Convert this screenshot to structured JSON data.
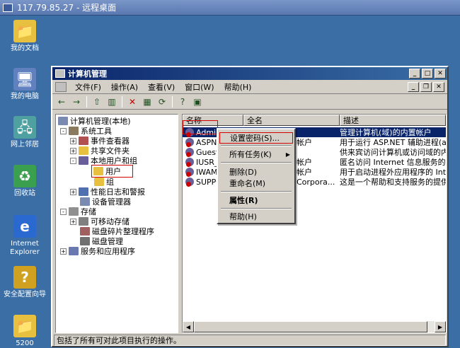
{
  "remote": {
    "title": "117.79.85.27 - 远程桌面"
  },
  "desktop_icons": [
    {
      "label": "我的文档",
      "icon": "folder-docs-icon",
      "color": "#e8c040"
    },
    {
      "label": "我的电脑",
      "icon": "computer-icon",
      "color": "#6080c0"
    },
    {
      "label": "网上邻居",
      "icon": "network-icon",
      "color": "#4fa0a0"
    },
    {
      "label": "回收站",
      "icon": "recycle-bin-icon",
      "color": "#3aa050"
    },
    {
      "label": "Internet Explorer",
      "icon": "ie-icon",
      "color": "#2a6ad0"
    },
    {
      "label": "安全配置向导",
      "icon": "security-wizard-icon",
      "color": "#d0a020"
    },
    {
      "label": "5200",
      "icon": "folder-icon",
      "color": "#e8c040"
    }
  ],
  "window": {
    "title": "计算机管理",
    "menu": [
      "文件(F)",
      "操作(A)",
      "查看(V)",
      "窗口(W)",
      "帮助(H)"
    ],
    "status": "包括了所有可对此项目执行的操作。"
  },
  "tree": [
    {
      "label": "计算机管理(本地)",
      "exp": ""
    },
    {
      "label": "系统工具",
      "exp": "-"
    },
    {
      "label": "事件查看器",
      "exp": "+"
    },
    {
      "label": "共享文件夹",
      "exp": "+"
    },
    {
      "label": "本地用户和组",
      "exp": "-"
    },
    {
      "label": "用户",
      "exp": ""
    },
    {
      "label": "组",
      "exp": ""
    },
    {
      "label": "性能日志和警报",
      "exp": "+"
    },
    {
      "label": "设备管理器",
      "exp": ""
    },
    {
      "label": "存储",
      "exp": "-"
    },
    {
      "label": "可移动存储",
      "exp": "+"
    },
    {
      "label": "磁盘碎片整理程序",
      "exp": ""
    },
    {
      "label": "磁盘管理",
      "exp": ""
    },
    {
      "label": "服务和应用程序",
      "exp": "+"
    }
  ],
  "list": {
    "columns": [
      "名称",
      "全名",
      "描述"
    ],
    "rows": [
      {
        "name": "Administr",
        "full": "",
        "desc": "管理计算机(域)的内置帐户"
      },
      {
        "name": "ASPNET",
        "full": "帐户",
        "desc": "用于运行 ASP.NET 辅助进程(as"
      },
      {
        "name": "Guest",
        "full": "",
        "desc": "供来宾访问计算机或访问域的内"
      },
      {
        "name": "IUSR_B",
        "full": "帐户",
        "desc": "匿名访问 Internet 信息服务的"
      },
      {
        "name": "IWAM_B",
        "full": "帐户",
        "desc": "用于启动进程外应用程序的 Int"
      },
      {
        "name": "SUPPOR",
        "full": "Corpora...",
        "desc": "这是一个帮助和支持服务的提供"
      }
    ]
  },
  "context_menu": {
    "set_password": "设置密码(S)...",
    "all_tasks": "所有任务(K)",
    "delete": "删除(D)",
    "rename": "重命名(M)",
    "properties": "属性(R)",
    "help": "帮助(H)"
  }
}
